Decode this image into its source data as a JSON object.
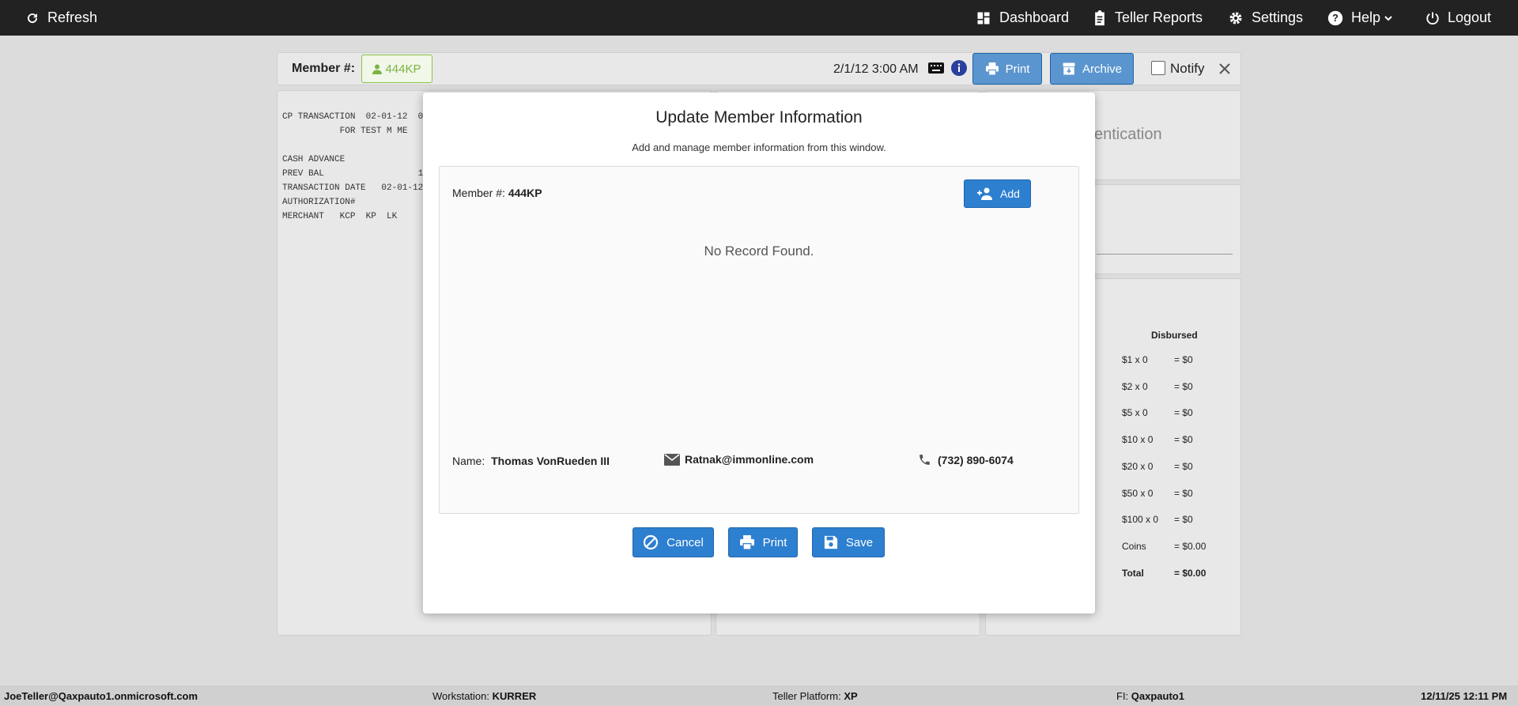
{
  "topbar": {
    "refresh": "Refresh",
    "dashboard": "Dashboard",
    "teller_reports": "Teller Reports",
    "settings": "Settings",
    "help": "Help",
    "logout": "Logout"
  },
  "header_bar": {
    "member_label": "Member #:",
    "member_value": "444KP",
    "datetime": "2/1/12 3:00 AM",
    "print": "Print",
    "archive": "Archive",
    "notify": "Notify"
  },
  "receipt_lines": [
    "CP TRANSACTION  02-01-12  0",
    "           FOR TEST M ME",
    "",
    "CASH ADVANCE",
    "PREV BAL                  1",
    "TRANSACTION DATE   02-01-12",
    "AUTHORIZATION#",
    "MERCHANT   KCP  KP  LK"
  ],
  "right_panel": {
    "auth_fragment": "entication",
    "disbursed_header": "Disbursed",
    "denominations": [
      {
        "label": "$1 x 0",
        "value": "= $0"
      },
      {
        "label": "$2 x 0",
        "value": "= $0"
      },
      {
        "label": "$5 x 0",
        "value": "= $0"
      },
      {
        "label": "$10 x 0",
        "value": "= $0"
      },
      {
        "label": "$20 x 0",
        "value": "= $0"
      },
      {
        "label": "$50 x 0",
        "value": "= $0"
      },
      {
        "label": "$100 x 0",
        "value": "= $0"
      },
      {
        "label": "Coins",
        "value": "= $0.00"
      },
      {
        "label": "Total",
        "value": "= $0.00"
      }
    ]
  },
  "modal": {
    "title": "Update Member Information",
    "subtitle": "Add and manage member information from this window.",
    "member_label": "Member #:",
    "member_value": "444KP",
    "add_button": "Add",
    "no_record": "No Record Found.",
    "name_label": "Name:",
    "name_value": "Thomas VonRueden III",
    "email": "Ratnak@immonline.com",
    "phone": "(732) 890-6074",
    "cancel": "Cancel",
    "print": "Print",
    "save": "Save"
  },
  "statusbar": {
    "user": "JoeTeller@Qaxpauto1.onmicrosoft.com",
    "workstation_label": "Workstation:",
    "workstation_value": "KURRER",
    "platform_label": "Teller Platform:",
    "platform_value": "XP",
    "fi_label": "FI:",
    "fi_value": "Qaxpauto1",
    "datetime": "12/11/25 12:11 PM"
  },
  "colors": {
    "topbar": "#222222",
    "accent_blue": "#2d7fd0",
    "member_badge": "#7cb342"
  }
}
